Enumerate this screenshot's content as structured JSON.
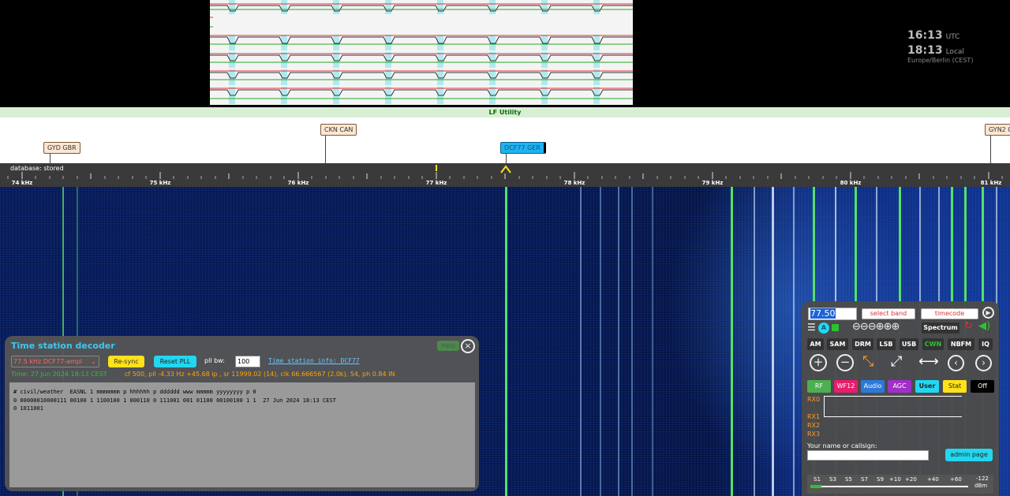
{
  "clock": {
    "utc_time": "16:13",
    "utc_label": "UTC",
    "local_time": "18:13",
    "local_label": "Local",
    "timezone": "Europe/Berlin (CEST)"
  },
  "band": {
    "name": "LF Utility"
  },
  "dx_labels": [
    {
      "text": "GYD GBR"
    },
    {
      "text": "CKN CAN"
    },
    {
      "text": "DCF77 GER"
    },
    {
      "text": "GYN2 G"
    }
  ],
  "scale": {
    "database_label": "database: stored",
    "ticks": [
      "74 kHz",
      "75 kHz",
      "76 kHz",
      "77 kHz",
      "78 kHz",
      "79 kHz",
      "80 kHz",
      "81 kHz"
    ]
  },
  "decoder": {
    "title": "Time station decoder",
    "help_label": "Help",
    "close_icon": "×",
    "station_select": "77.5 kHz DCF77-ampl",
    "resync_label": "Re-sync",
    "reset_pll_label": "Reset PLL",
    "pll_bw_label": "pll bw:",
    "pll_bw_value": "100",
    "info_link": "Time station info: DCF77",
    "status_time": "Time: 27 Jun 2024 18:13 CEST",
    "status_details": "cf 500, pll -4.33 Hz +45.68 ip , sr 11999.02 (14), clk 66.666567 (2.0k), 54, ph 0.84 IN",
    "log_lines": [
      "# civil/weather  EASNL 1 mmmmmmm p hhhhhh p dddddd www mmmmm yyyyyyyy p 0",
      "0 00000010000111 00100 1 1100100 1 000110 0 111001 001 01100 00100100 1 1  27 Jun 2024 18:13 CEST",
      "0 1011001"
    ]
  },
  "ctrl": {
    "frequency": "77.50",
    "band_select": "select band",
    "ext_select": "timecode",
    "spectrum_label": "Spectrum",
    "modes": [
      "AM",
      "SAM",
      "DRM",
      "LSB",
      "USB",
      "CWN",
      "NBFM",
      "IQ"
    ],
    "tabs": [
      "RF",
      "WF12",
      "Audio",
      "AGC",
      "User",
      "Stat",
      "Off"
    ],
    "rx_labels": [
      "RX0",
      "RX1",
      "RX2",
      "RX3"
    ],
    "name_label": "Your name or callsign:",
    "name_value": "",
    "admin_label": "admin page",
    "smeter_labels": [
      "S1",
      "S3",
      "S5",
      "S7",
      "S9",
      "+10",
      "+20",
      "+40",
      "+60"
    ],
    "smeter_value": "-122",
    "smeter_unit": "dBm",
    "colors": {
      "accent_cyan": "#22d7f0",
      "cwn_green": "#2ec22e"
    }
  }
}
